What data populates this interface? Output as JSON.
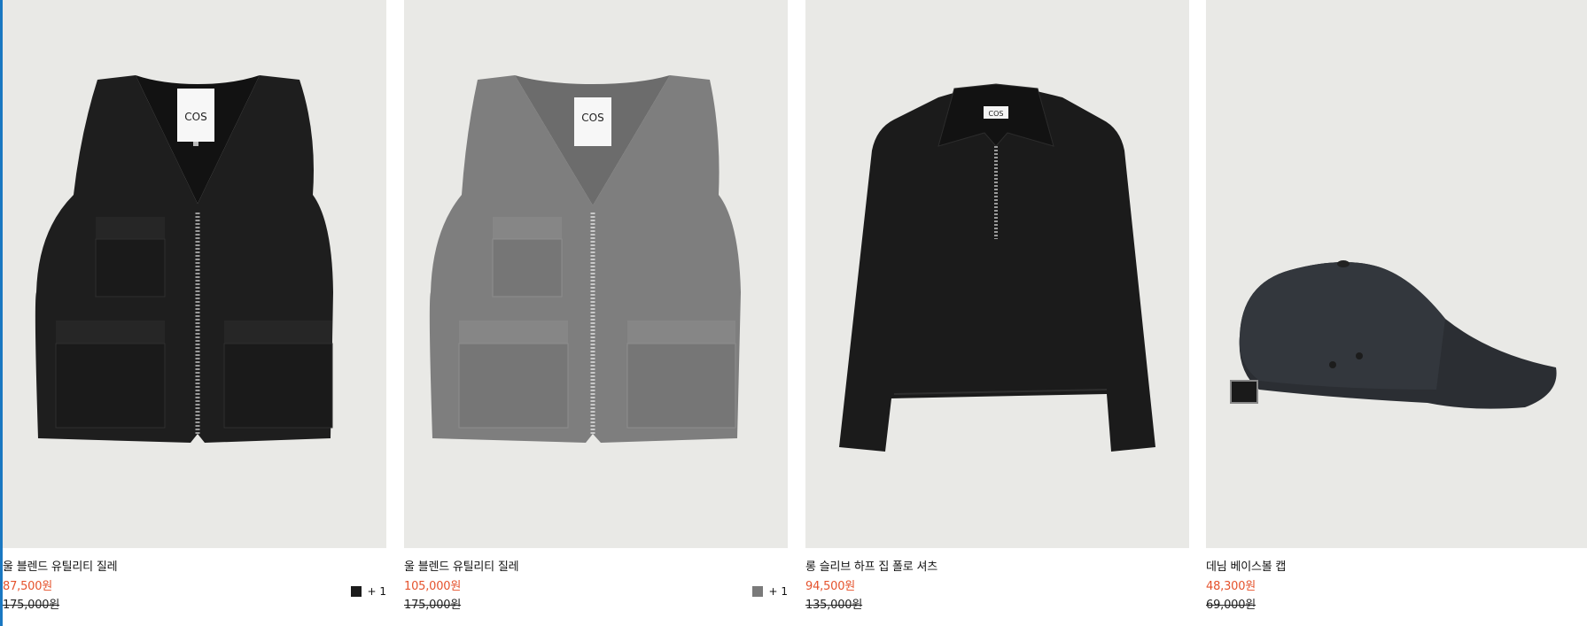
{
  "products": [
    {
      "name": "울 블렌드 유틸리티 질레",
      "sale_price": "87,500원",
      "original_price": "175,000원",
      "swatch_color": "#1c1c1c",
      "more_colors": "+ 1",
      "image": "black-utility-vest",
      "label_text": "COS"
    },
    {
      "name": "울 블렌드 유틸리티 질레",
      "sale_price": "105,000원",
      "original_price": "175,000원",
      "swatch_color": "#7a7a7a",
      "more_colors": "+ 1",
      "image": "grey-utility-vest",
      "label_text": "COS"
    },
    {
      "name": "롱 슬리브 하프 집 폴로 셔츠",
      "sale_price": "94,500원",
      "original_price": "135,000원",
      "image": "black-half-zip-polo",
      "label_text": "COS"
    },
    {
      "name": "데님 베이스볼 캡",
      "sale_price": "48,300원",
      "original_price": "69,000원",
      "image": "denim-baseball-cap"
    }
  ],
  "colors": {
    "sale": "#e5532d",
    "image_background": "#e9e9e6",
    "edge_accent": "#1a78c2"
  }
}
